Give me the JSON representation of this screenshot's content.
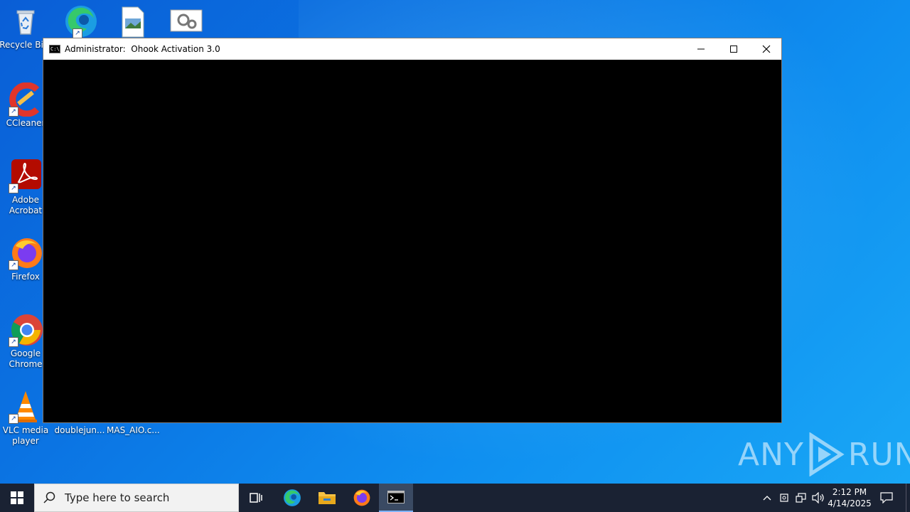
{
  "desktop": {
    "icons": [
      {
        "label": "Recycle Bin",
        "display": "Recycle Bi"
      },
      {
        "label": "CCleaner"
      },
      {
        "label": "Adobe Acrobat",
        "line1": "Adobe",
        "line2": "Acrobat"
      },
      {
        "label": "Firefox"
      },
      {
        "label": "Google Chrome",
        "line1": "Google",
        "line2": "Chrome"
      },
      {
        "label": "VLC media player",
        "line1": "VLC media",
        "line2": "player"
      },
      {
        "label": "doublejun..."
      },
      {
        "label": "MAS_AIO.c..."
      }
    ],
    "watermark": {
      "left": "ANY",
      "right": "RUN"
    }
  },
  "window": {
    "title": "Administrator:  Ohook Activation 3.0",
    "minimize_icon": "minimize-icon",
    "maximize_icon": "maximize-icon",
    "close_icon": "close-icon"
  },
  "taskbar": {
    "search_placeholder": "Type here to search",
    "apps": [
      "task-view",
      "edge",
      "file-explorer",
      "firefox",
      "command-prompt"
    ],
    "clock": {
      "time": "2:12 PM",
      "date": "4/14/2025"
    }
  },
  "colors": {
    "desktop_accent": "#0b74e3",
    "taskbar": "#1a2233",
    "console": "#000000"
  }
}
